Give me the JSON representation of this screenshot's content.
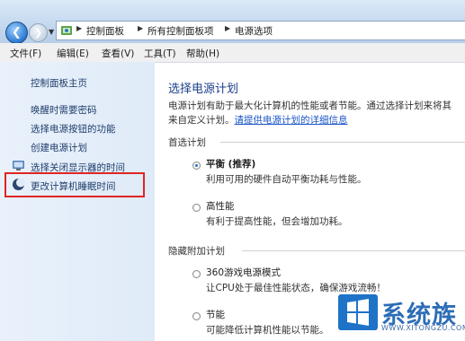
{
  "address_bar": {
    "breadcrumbs": [
      "控制面板",
      "所有控制面板项",
      "电源选项"
    ]
  },
  "menu": {
    "items": [
      "文件(F)",
      "编辑(E)",
      "查看(V)",
      "工具(T)",
      "帮助(H)"
    ]
  },
  "sidebar": {
    "home": "控制面板主页",
    "links": [
      "唤醒时需要密码",
      "选择电源按钮的功能",
      "创建电源计划",
      "选择关闭显示器的时间",
      "更改计算机睡眠时间"
    ]
  },
  "main": {
    "title": "选择电源计划",
    "desc_line1": "电源计划有助于最大化计算机的性能或者节能。通过选择计划来将其",
    "desc_line2_prefix": "来自定义计划。",
    "desc_link": "请提供电源计划的详细信息",
    "preferred_label": "首选计划",
    "hidden_label": "隐藏附加计划",
    "plans": [
      {
        "name": "平衡 (推荐)",
        "desc": "利用可用的硬件自动平衡功耗与性能。",
        "selected": true
      },
      {
        "name": "高性能",
        "desc": "有利于提高性能，但会增加功耗。",
        "selected": false
      },
      {
        "name": "360游戏电源模式",
        "desc": "让CPU处于最佳性能状态，确保游戏流畅！",
        "selected": false
      },
      {
        "name": "节能",
        "desc": "可能降低计算机性能以节能。",
        "selected": false
      }
    ]
  },
  "watermark": {
    "brand": "系统族",
    "url": "WWW.XITONGZU.COM"
  }
}
